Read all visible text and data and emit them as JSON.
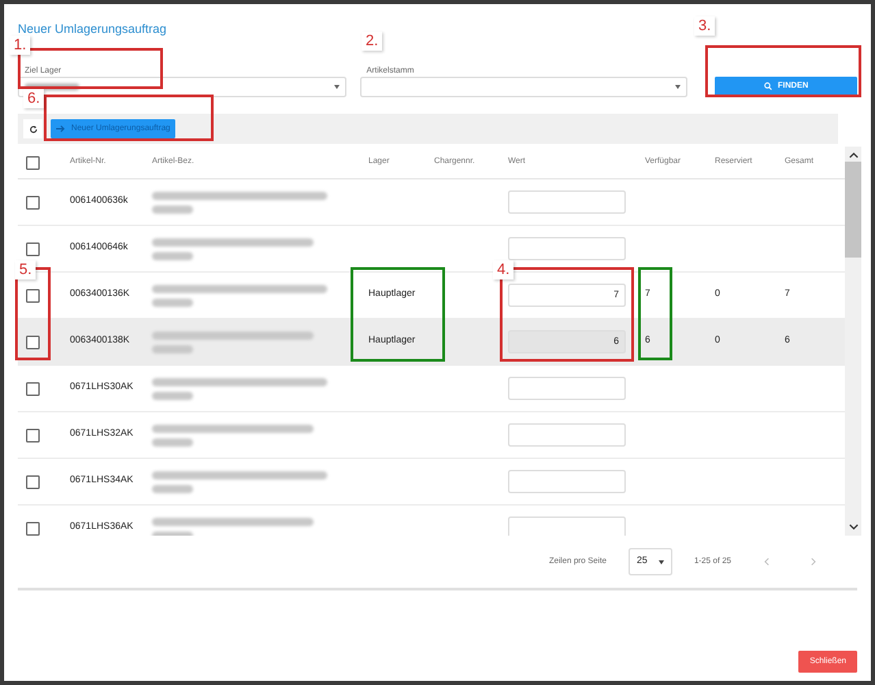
{
  "dialog": {
    "title": "Neuer Umlagerungsauftrag"
  },
  "filters": [
    {
      "label": "Ziel Lager",
      "blurred_value": true
    },
    {
      "label": "Artikelstamm",
      "blurred_value": false
    }
  ],
  "find_button": {
    "label": "FINDEN"
  },
  "toolbar": {
    "new_button": {
      "label": "Neuer Umlagerungsauftrag"
    }
  },
  "table": {
    "select_all": {
      "checked": false
    },
    "columns": [
      "Artikel-Nr.",
      "Artikel-Bez.",
      "Lager",
      "Chargennr.",
      "Wert",
      "Verfügbar",
      "Reserviert",
      "Gesamt"
    ],
    "rows": [
      {
        "checked": false,
        "highlighted": false,
        "artikel_nr": "0061400636k",
        "lager": "",
        "wert": "",
        "wert_disabled": false,
        "verfuegbar": "",
        "reserviert": "",
        "gesamt": ""
      },
      {
        "checked": false,
        "highlighted": false,
        "artikel_nr": "0061400646k",
        "lager": "",
        "wert": "",
        "wert_disabled": false,
        "verfuegbar": "",
        "reserviert": "",
        "gesamt": ""
      },
      {
        "checked": false,
        "highlighted": false,
        "artikel_nr": "0063400136K",
        "lager": "Hauptlager",
        "wert": "7",
        "wert_disabled": false,
        "verfuegbar": "7",
        "reserviert": "0",
        "gesamt": "7"
      },
      {
        "checked": false,
        "highlighted": true,
        "artikel_nr": "0063400138K",
        "lager": "Hauptlager",
        "wert": "6",
        "wert_disabled": true,
        "verfuegbar": "6",
        "reserviert": "0",
        "gesamt": "6"
      },
      {
        "checked": false,
        "highlighted": false,
        "artikel_nr": "0671LHS30AK",
        "lager": "",
        "wert": "",
        "wert_disabled": false,
        "verfuegbar": "",
        "reserviert": "",
        "gesamt": ""
      },
      {
        "checked": false,
        "highlighted": false,
        "artikel_nr": "0671LHS32AK",
        "lager": "",
        "wert": "",
        "wert_disabled": false,
        "verfuegbar": "",
        "reserviert": "",
        "gesamt": ""
      },
      {
        "checked": false,
        "highlighted": false,
        "artikel_nr": "0671LHS34AK",
        "lager": "",
        "wert": "",
        "wert_disabled": false,
        "verfuegbar": "",
        "reserviert": "",
        "gesamt": ""
      },
      {
        "checked": false,
        "highlighted": false,
        "artikel_nr": "0671LHS36AK",
        "lager": "",
        "wert": "",
        "wert_disabled": false,
        "verfuegbar": "",
        "reserviert": "",
        "gesamt": ""
      }
    ]
  },
  "pagination": {
    "rows_per_page_label": "Zeilen pro Seite",
    "rows_per_page": "25",
    "range": "1-25 of 25"
  },
  "close_button": {
    "label": "Schließen"
  },
  "annotations": [
    {
      "label": "1.",
      "color": "#d32f2f"
    },
    {
      "label": "2.",
      "color": "#d32f2f"
    },
    {
      "label": "3.",
      "color": "#d32f2f"
    },
    {
      "label": "4.",
      "color": "#d32f2f"
    },
    {
      "label": "5.",
      "color": "#d32f2f"
    },
    {
      "label": "6.",
      "color": "#d32f2f"
    }
  ],
  "highlight_boxes": [
    {
      "color": "#d32f2f"
    },
    {
      "color": "#d32f2f"
    },
    {
      "color": "#d32f2f"
    },
    {
      "color": "#d32f2f"
    },
    {
      "color": "#d32f2f"
    },
    {
      "color": "#1b8a1b"
    },
    {
      "color": "#1b8a1b"
    }
  ]
}
